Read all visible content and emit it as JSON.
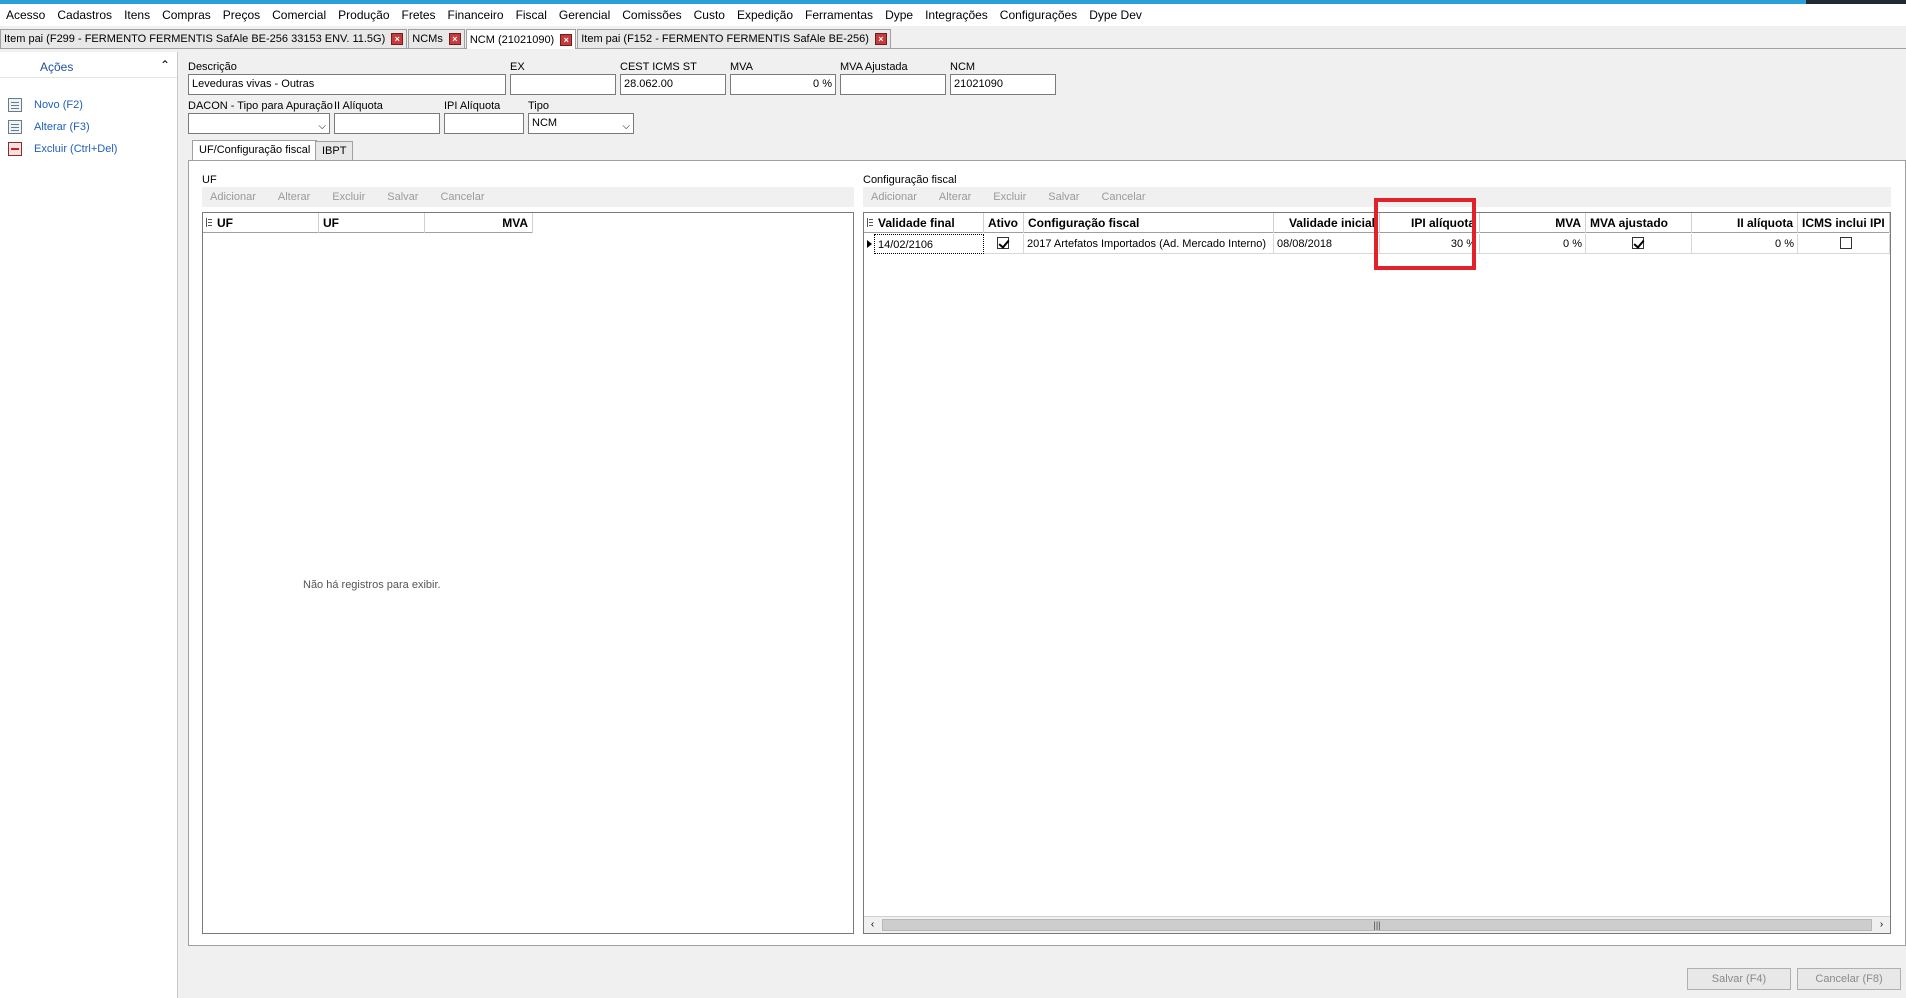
{
  "menu": [
    "Acesso",
    "Cadastros",
    "Itens",
    "Compras",
    "Preços",
    "Comercial",
    "Produção",
    "Fretes",
    "Financeiro",
    "Fiscal",
    "Gerencial",
    "Comissões",
    "Custo",
    "Expedição",
    "Ferramentas",
    "Dype",
    "Integrações",
    "Configurações",
    "Dype Dev"
  ],
  "doc_tabs": [
    {
      "label": "Item pai (F299 - FERMENTO FERMENTIS SafAle BE-256 33153 ENV. 11.5G)",
      "active": false
    },
    {
      "label": "NCMs",
      "active": false
    },
    {
      "label": "NCM (21021090)",
      "active": true
    },
    {
      "label": "Item pai (F152 - FERMENTO FERMENTIS SafAle BE-256)",
      "active": false
    }
  ],
  "sidebar": {
    "title": "Ações",
    "actions": [
      {
        "label": "Novo (F2)",
        "icon": "new-document-icon"
      },
      {
        "label": "Alterar (F3)",
        "icon": "edit-document-icon"
      },
      {
        "label": "Excluir (Ctrl+Del)",
        "icon": "delete-document-icon"
      }
    ]
  },
  "form": {
    "descricao_label": "Descrição",
    "descricao_value": "Leveduras vivas - Outras",
    "ex_label": "EX",
    "ex_value": "",
    "cest_label": "CEST ICMS ST",
    "cest_value": "28.062.00",
    "mva_label": "MVA",
    "mva_value": "0 %",
    "mva_ajustada_label": "MVA Ajustada",
    "mva_ajustada_value": "",
    "ncm_label": "NCM",
    "ncm_value": "21021090",
    "dacon_label": "DACON - Tipo para Apuração",
    "dacon_value": "",
    "ii_label": "II Alíquota",
    "ii_value": "",
    "ipi_label": "IPI Alíquota",
    "ipi_value": "",
    "tipo_label": "Tipo",
    "tipo_value": "NCM"
  },
  "sub_tabs": [
    {
      "label": "UF/Configuração fiscal",
      "active": true
    },
    {
      "label": "IBPT",
      "active": false
    }
  ],
  "uf_section": {
    "title": "UF",
    "toolbar": [
      "Adicionar",
      "Alterar",
      "Excluir",
      "Salvar",
      "Cancelar"
    ],
    "columns": [
      "UF",
      "UF",
      "MVA"
    ],
    "empty_text": "Não há registros para exibir."
  },
  "config_section": {
    "title": "Configuração fiscal",
    "toolbar": [
      "Adicionar",
      "Alterar",
      "Excluir",
      "Salvar",
      "Cancelar"
    ],
    "columns": [
      "Validade final",
      "Ativo",
      "Configuração fiscal",
      "Validade inicial",
      "IPI alíquota",
      "MVA",
      "MVA ajustado",
      "II alíquota",
      "ICMS inclui IPI"
    ],
    "rows": [
      {
        "validade_final": "14/02/2106",
        "ativo": true,
        "configuracao_fiscal": "2017 Artefatos Importados (Ad. Mercado Interno)",
        "validade_inicial": "08/08/2018",
        "ipi_aliquota": "30 %",
        "mva": "0 %",
        "mva_ajustado": true,
        "ii_aliquota": "0 %",
        "icms_inclui_ipi": false
      }
    ]
  },
  "bottom_buttons": {
    "save": "Salvar (F4)",
    "cancel": "Cancelar (F8)"
  },
  "colors": {
    "highlight": "#e2212b",
    "link": "#1e5fb8",
    "accent": "#2ba0d8"
  }
}
